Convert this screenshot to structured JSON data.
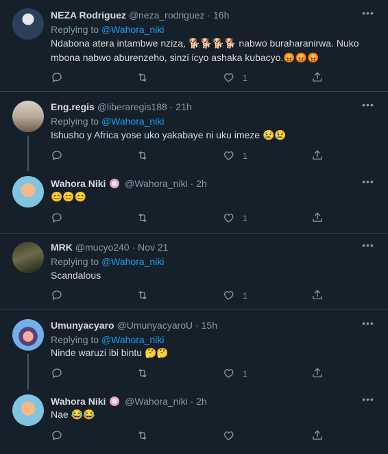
{
  "colors": {
    "background": "#15202b",
    "mention": "#1d9bf0",
    "muted": "#8899a6",
    "divider": "#38444d"
  },
  "tweets": [
    {
      "name": "NEZA Rodriguez",
      "handle": "@neza_rodriguez",
      "time": "16h",
      "replying_prefix": "Replying to ",
      "replying_to": "@Wahora_niki",
      "text1": "Ndabona atera intambwe nziza, 🐕🐕🐕🐕 nabwo buraharanirwa. Nuko",
      "text2": "mbona nabwo aburenzeho, sinzi icyo ashaka kubacyo.😡😡😡",
      "likes": "1"
    },
    {
      "name": "Eng.regis",
      "handle": "@liberaregis188",
      "time": "21h",
      "replying_prefix": "Replying to ",
      "replying_to": "@Wahora_niki",
      "text1": "Ishusho y Africa yose uko yakabaye ni uku imeze 😢😢",
      "likes": "1"
    },
    {
      "name": "Wahora Niki",
      "handle": "@Wahora_niki",
      "time": "2h",
      "text1": "😊😊😊",
      "likes": "1"
    },
    {
      "name": "MRK",
      "handle": "@mucyo240",
      "time": "Nov 21",
      "replying_prefix": "Replying to ",
      "replying_to": "@Wahora_niki",
      "text1": "Scandalous",
      "likes": "1"
    },
    {
      "name": "Umunyacyaro",
      "handle": "@UmunyacyaroU",
      "time": "15h",
      "replying_prefix": "Replying to ",
      "replying_to": "@Wahora_niki",
      "text1": "Ninde waruzi ibi bintu 🤔🤔",
      "likes": "1"
    },
    {
      "name": "Wahora Niki",
      "handle": "@Wahora_niki",
      "time": "2h",
      "text1": "Nae 😂😂",
      "likes": ""
    }
  ],
  "separator": "·",
  "more_label": "•••"
}
